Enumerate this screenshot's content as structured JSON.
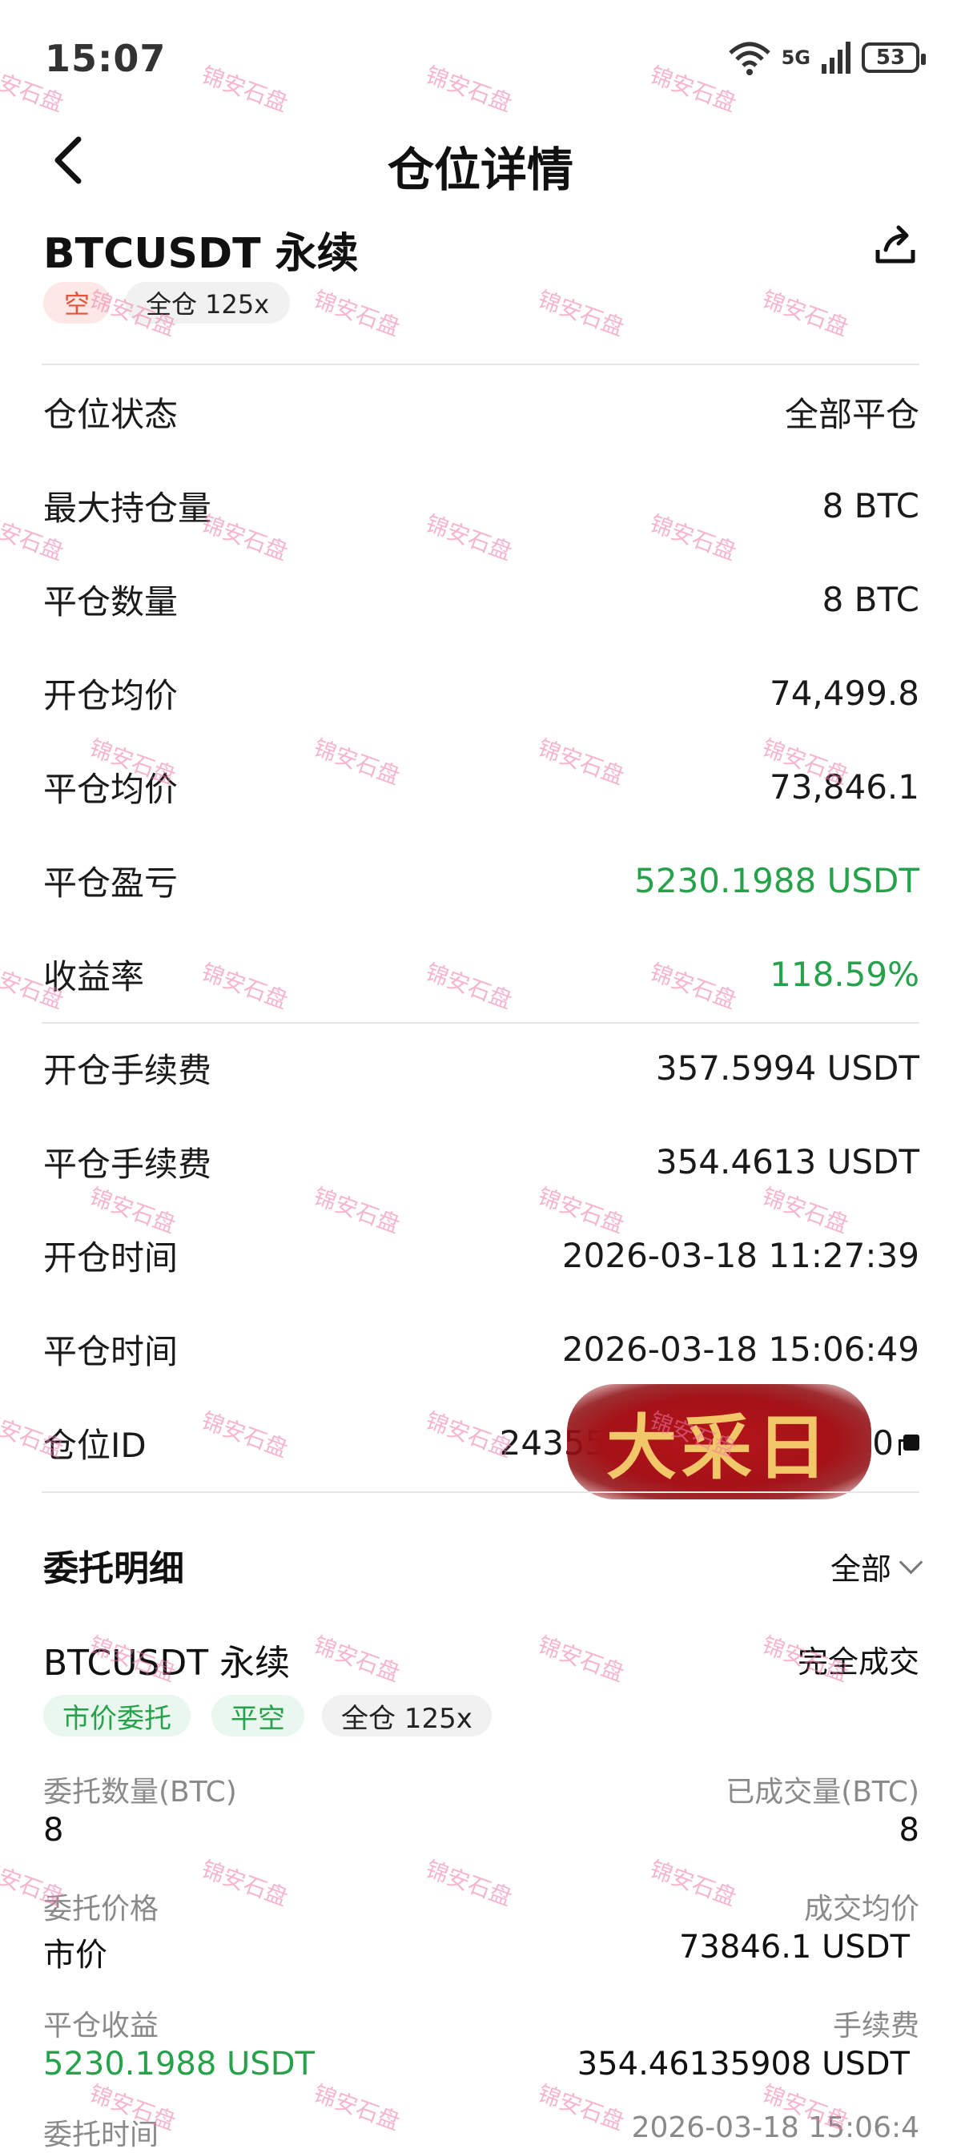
{
  "status_bar": {
    "time": "15:07",
    "network": "5G",
    "battery": "53"
  },
  "header": {
    "title": "仓位详情"
  },
  "position": {
    "symbol": "BTCUSDT 永续",
    "side_tag": "空",
    "margin_tag": "全仓 125x"
  },
  "details": [
    {
      "label": "仓位状态",
      "value": "全部平仓",
      "color": "#1a1a1a"
    },
    {
      "label": "最大持仓量",
      "value": "8 BTC",
      "color": "#1a1a1a"
    },
    {
      "label": "平仓数量",
      "value": "8 BTC",
      "color": "#1a1a1a"
    },
    {
      "label": "开仓均价",
      "value": "74,499.8",
      "color": "#1a1a1a"
    },
    {
      "label": "平仓均价",
      "value": "73,846.1",
      "color": "#1a1a1a"
    },
    {
      "label": "平仓盈亏",
      "value": "5230.1988 USDT",
      "color": "#25a24a"
    },
    {
      "label": "收益率",
      "value": "118.59%",
      "color": "#25a24a"
    },
    {
      "label": "开仓手续费",
      "value": "357.5994 USDT",
      "color": "#1a1a1a"
    },
    {
      "label": "平仓手续费",
      "value": "354.4613 USDT",
      "color": "#1a1a1a"
    },
    {
      "label": "开仓时间",
      "value": "2026-03-18 11:27:39",
      "color": "#1a1a1a"
    },
    {
      "label": "平仓时间",
      "value": "2026-03-18 15:06:49",
      "color": "#1a1a1a"
    },
    {
      "label": "仓位ID",
      "value": "24355",
      "value_suffix": "0",
      "color": "#1a1a1a"
    }
  ],
  "stamp_text": "大采日",
  "orders": {
    "section_title": "委托明细",
    "filter_label": "全部",
    "item": {
      "symbol": "BTCUSDT 永续",
      "status": "完全成交",
      "tags": [
        "市价委托",
        "平空",
        "全仓 125x"
      ],
      "fields": {
        "order_qty_label": "委托数量(BTC)",
        "order_qty_value": "8",
        "filled_qty_label": "已成交量(BTC)",
        "filled_qty_value": "8",
        "order_price_label": "委托价格",
        "order_price_value": "市价",
        "avg_price_label": "成交均价",
        "avg_price_value": "73846.1 USDT",
        "pnl_label": "平仓收益",
        "pnl_value": "5230.1988 USDT",
        "fee_label": "手续费",
        "fee_value": "354.46135908 USDT",
        "time_label": "委托时间",
        "time_value": "2026-03-18 15:06:4"
      }
    }
  },
  "watermark": "锦安石盘",
  "colors": {
    "profit_green": "#25a24a",
    "short_red": "#e5533d"
  }
}
